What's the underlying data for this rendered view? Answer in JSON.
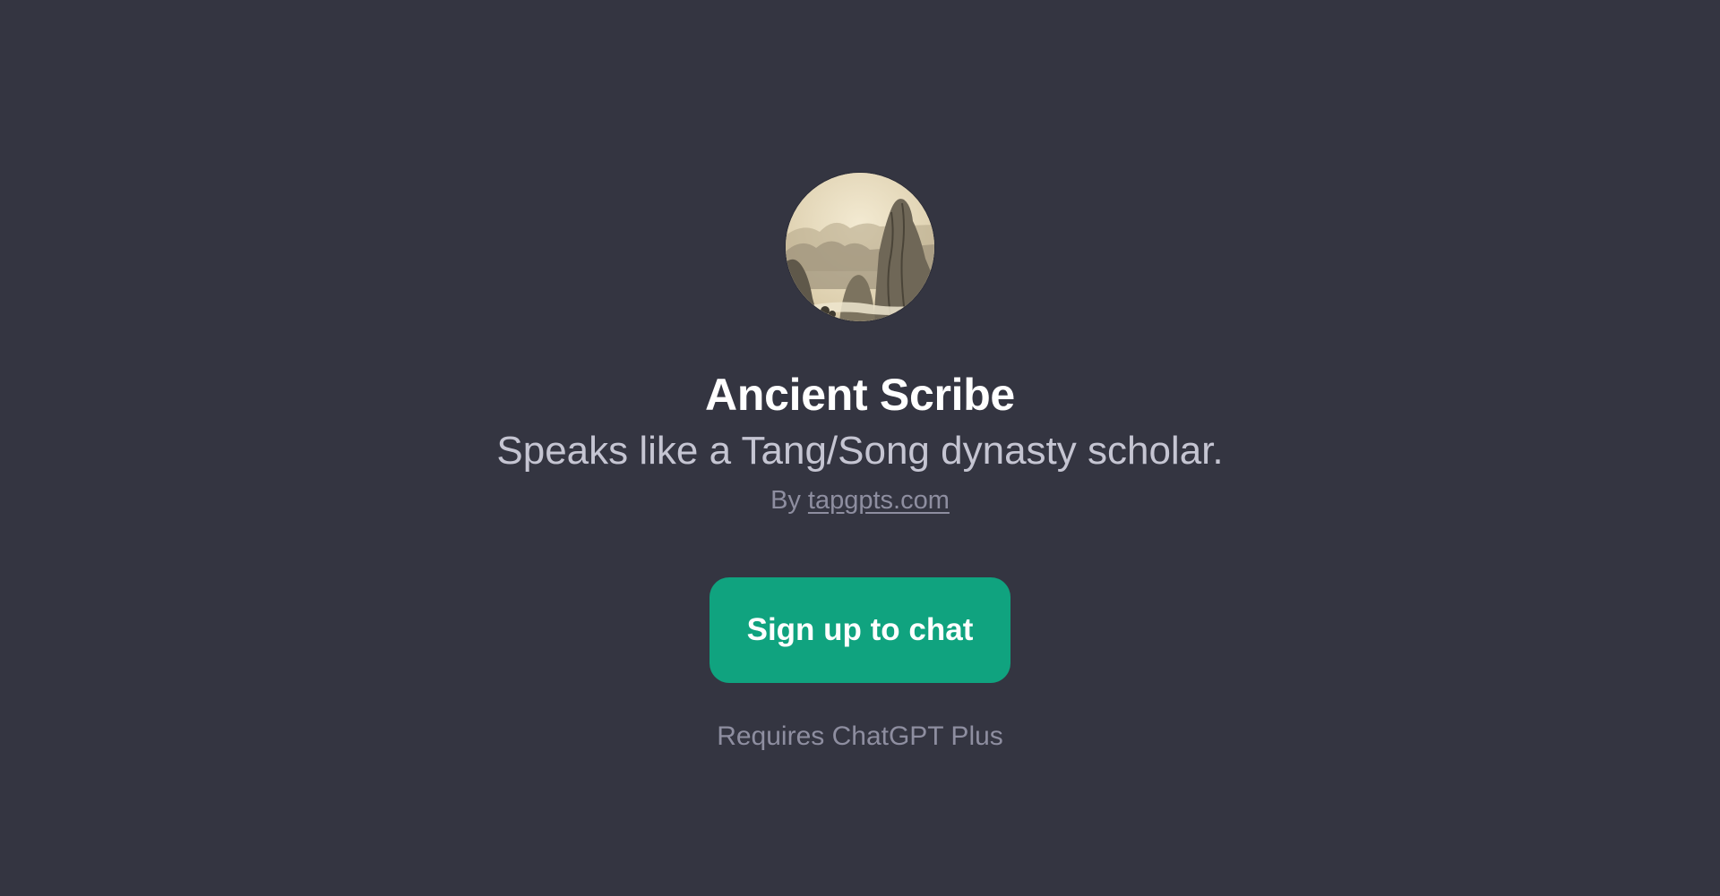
{
  "gpt": {
    "avatar_icon": "mountain-landscape-avatar-icon",
    "name": "Ancient Scribe",
    "description": "Speaks like a Tang/Song dynasty scholar.",
    "by_label": "By",
    "author_link": "tapgpts.com"
  },
  "actions": {
    "signup_label": "Sign up to chat",
    "requirement_text": "Requires ChatGPT Plus"
  },
  "colors": {
    "background": "#343541",
    "accent": "#10a37f",
    "title": "#ffffff",
    "subtitle": "#c5c5d2",
    "muted": "#8e8ea0"
  }
}
